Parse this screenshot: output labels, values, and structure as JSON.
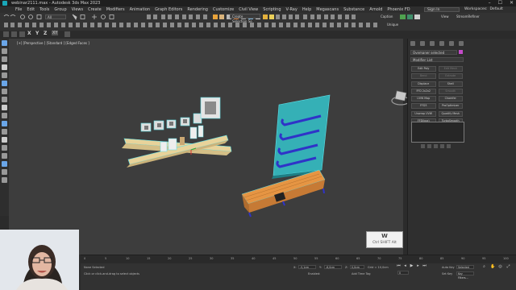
{
  "window": {
    "title": "webinar2111.max - Autodesk 3ds Max 2023",
    "controls": [
      "–",
      "☐",
      "✕"
    ]
  },
  "menu": {
    "items": [
      "File",
      "Edit",
      "Tools",
      "Group",
      "Views",
      "Create",
      "Modifiers",
      "Animation",
      "Graph Editors",
      "Rendering",
      "Customize",
      "Civil View",
      "Scripting",
      "V-Ray",
      "Help",
      "Megascans",
      "Substance",
      "Arnold",
      "Phoenix FD"
    ],
    "sign_in": "Sign In",
    "workspaces_label": "Workspaces:",
    "workspace_value": "Default"
  },
  "toolbar": {
    "filter_value": "All",
    "create_selection_set": "Create Selection Se",
    "caption_label": "Caption",
    "stream_refiner": "StreamRefiner",
    "unique": "Unique",
    "view_label": "View"
  },
  "scene_tabs": [
    "X",
    "Y",
    "Z",
    "XY"
  ],
  "viewport": {
    "label": "[+] [Perspective ] [Standard ] [Edged Faces ]"
  },
  "command_panel": {
    "object_name": "Ovemaner selected",
    "modifier_list": "Modifier List",
    "modifier_buttons": [
      {
        "label": "Edit Poly",
        "dim": false
      },
      {
        "label": "Edit Mesh",
        "dim": true
      },
      {
        "label": "Bend",
        "dim": true
      },
      {
        "label": "Extrude",
        "dim": true
      },
      {
        "label": "Displace",
        "dim": false
      },
      {
        "label": "Shell",
        "dim": false
      },
      {
        "label": "FFD 2x2x2",
        "dim": false
      },
      {
        "label": "Smooth",
        "dim": true
      },
      {
        "label": "UVW Map",
        "dim": false
      },
      {
        "label": "Chamfer",
        "dim": false
      },
      {
        "label": "FFD3",
        "dim": false
      },
      {
        "label": "ProOptimizer",
        "dim": false
      },
      {
        "label": "Unwrap UVW",
        "dim": false
      },
      {
        "label": "Quadify Mesh",
        "dim": false
      },
      {
        "label": "FFD(box)",
        "dim": false
      },
      {
        "label": "TurboSmooth",
        "dim": false
      }
    ],
    "camera_resolution": "Camera Resolution"
  },
  "timeline": {
    "ticks": [
      "0",
      "5",
      "10",
      "15",
      "20",
      "25",
      "30",
      "35",
      "40",
      "45",
      "50",
      "55",
      "60",
      "65",
      "70",
      "75",
      "80",
      "85",
      "90",
      "95",
      "100"
    ]
  },
  "status": {
    "selected": "None Selected",
    "hint": "Click or click-and-drag to select objects",
    "x_label": "X:",
    "x_value": "-5,1cm",
    "y_label": "Y:",
    "y_value": "-6,0cm",
    "z_label": "Z:",
    "z_value": "0,0cm",
    "grid": "Grid = 10,0cm",
    "enabled": "Enabled:",
    "add_time_tag": "Add Time Tag",
    "auto_key": "Auto Key",
    "selected_dropdown": "Selected",
    "set_key": "Set Key",
    "key_filters": "Key Filters...",
    "frame": "0"
  },
  "keyboard_overlay": {
    "key": "W",
    "shortcut": "Ctrl SHIFT Alt"
  }
}
